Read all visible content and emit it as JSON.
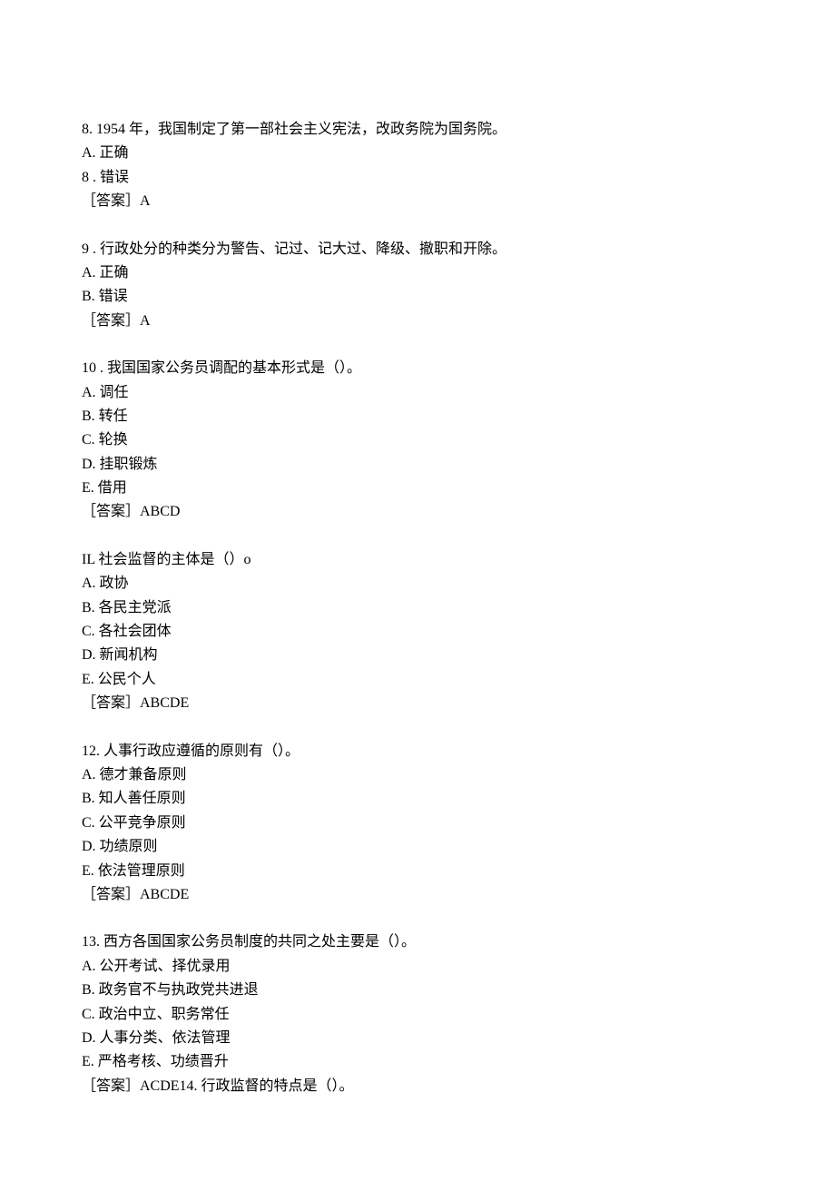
{
  "questions": [
    {
      "stem": "8. 1954 年，我国制定了第一部社会主义宪法，改政务院为国务院。",
      "options": [
        "A. 正确",
        "8 . 错误"
      ],
      "answer": "［答案］A"
    },
    {
      "stem": "9 . 行政处分的种类分为警告、记过、记大过、降级、撤职和开除。",
      "options": [
        "A. 正确",
        "B. 错误"
      ],
      "answer": "［答案］A"
    },
    {
      "stem": "10 . 我国国家公务员调配的基本形式是（）。",
      "options": [
        "A. 调任",
        "B. 转任",
        "C. 轮换",
        "D. 挂职锻炼",
        "E. 借用"
      ],
      "answer": "［答案］ABCD"
    },
    {
      "stem": "IL 社会监督的主体是（）o",
      "options": [
        "A. 政协",
        "B. 各民主党派",
        "C. 各社会团体",
        "D. 新闻机构",
        "E. 公民个人"
      ],
      "answer": "［答案］ABCDE"
    },
    {
      "stem": "12. 人事行政应遵循的原则有（）。",
      "options": [
        "A. 德才兼备原则",
        "B. 知人善任原则",
        "C. 公平竞争原则",
        "D. 功绩原则",
        "E. 依法管理原则"
      ],
      "answer": "［答案］ABCDE"
    },
    {
      "stem": "13. 西方各国国家公务员制度的共同之处主要是（）。",
      "options": [
        "A. 公开考试、择优录用",
        "B. 政务官不与执政党共进退",
        "C. 政治中立、职务常任",
        "D. 人事分类、依法管理",
        "E. 严格考核、功绩晋升"
      ],
      "answer": "［答案］ACDE14. 行政监督的特点是（）。"
    }
  ]
}
